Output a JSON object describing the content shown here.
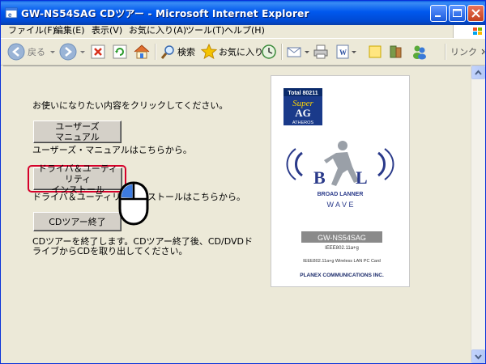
{
  "window": {
    "title": "GW-NS54SAG CDツアー - Microsoft Internet Explorer"
  },
  "menu": [
    "ファイル(F)",
    "編集(E)",
    "表示(V)",
    "お気に入り(A)",
    "ツール(T)",
    "ヘルプ(H)"
  ],
  "toolbar": {
    "back": "戻る",
    "search": "検索",
    "favorites": "お気に入り",
    "links": "リンク"
  },
  "page": {
    "intro": "お使いになりたい内容をクリックしてください。",
    "manual_button": [
      "ユーザーズ",
      "マニュアル"
    ],
    "manual_desc": "ユーザーズ・マニュアルはこちらから。",
    "install_button": [
      "ドライバ＆ユーティリティ",
      "インストール"
    ],
    "install_desc_left": "ドライバ＆ユーティリティ",
    "install_desc_right": "ストールはこちらから。",
    "exit_button": "CDツアー終了",
    "exit_desc_1": "CDツアーを終了します。CDツアー終了後、CD/DVDド",
    "exit_desc_2": "ライブからCDを取り出してください。"
  },
  "product": {
    "badge_top": "Total 80211",
    "badge_super": "Super",
    "badge_ag": "AG",
    "badge_atheros": "ATHEROS",
    "brand_b": "B",
    "brand_l": "L",
    "brand_name": "BROAD LANNER",
    "brand_wave": "W A V E",
    "model": "GW-NS54SAG",
    "standard": "IEEE802.11a+g",
    "description": "IEEE802.11a+g Wireless LAN PC Card",
    "maker": "PLANEX COMMUNICATIONS INC."
  },
  "colors": {
    "titlebar": "#0058ee",
    "highlight": "#d5002a",
    "face": "#ece9d8"
  }
}
